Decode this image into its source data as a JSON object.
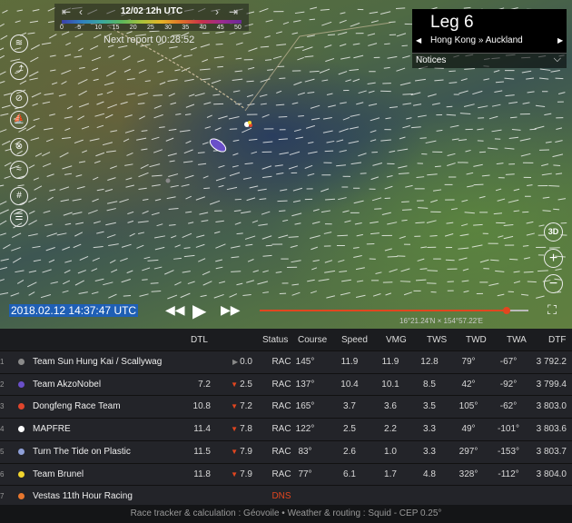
{
  "time_scale": {
    "date": "12/02 12h UTC",
    "ticks": [
      "0",
      "5",
      "10",
      "15",
      "20",
      "25",
      "30",
      "35",
      "40",
      "45",
      "50"
    ],
    "first_icon": "skip-back-icon",
    "prev_icon": "chevron-left-icon",
    "next_icon": "chevron-right-icon",
    "last_icon": "skip-forward-icon"
  },
  "next_report": "Next report 00:28:52",
  "leg": {
    "title": "Leg 6",
    "route": "Hong Kong » Auckland",
    "prev_icon": "chevron-left-icon",
    "next_icon": "chevron-right-icon",
    "notices": "Notices"
  },
  "tools": [
    "layers-icon",
    "route-icon",
    "compass-icon",
    "boat-icon",
    "compass-needle-icon",
    "wind-icon",
    "grid-icon",
    "ruler-icon"
  ],
  "map_controls": {
    "three_d": "3D",
    "zoom_in": "+",
    "zoom_out": "−"
  },
  "playback": {
    "timestamp": "2018.02.12 14:37:47 UTC",
    "progress": 0.92,
    "coords": "16°21.24'N × 154°57.22'E"
  },
  "table": {
    "headers": {
      "dtl": "DTL",
      "status": "Status",
      "course": "Course",
      "speed": "Speed",
      "vmg": "VMG",
      "tws": "TWS",
      "twd": "TWD",
      "twa": "TWA",
      "dtf": "DTF"
    },
    "rows": [
      {
        "rank": "1",
        "color": "#8a8a8a",
        "name": "Team Sun Hung Kai / Scallywag",
        "dtl": "",
        "delta": "0.0",
        "trend": "▶",
        "trend_color": "#888888",
        "status": "RAC",
        "course": "145°",
        "speed": "11.9",
        "vmg": "11.9",
        "tws": "12.8",
        "twd": "79°",
        "twa": "-67°",
        "dtf": "3 792.2"
      },
      {
        "rank": "2",
        "color": "#6a4fc9",
        "name": "Team AkzoNobel",
        "dtl": "7.2",
        "delta": "2.5",
        "trend": "▼",
        "trend_color": "#e2461f",
        "status": "RAC",
        "course": "137°",
        "speed": "10.4",
        "vmg": "10.1",
        "tws": "8.5",
        "twd": "42°",
        "twa": "-92°",
        "dtf": "3 799.4"
      },
      {
        "rank": "3",
        "color": "#e0452c",
        "name": "Dongfeng Race Team",
        "dtl": "10.8",
        "delta": "7.2",
        "trend": "▼",
        "trend_color": "#e2461f",
        "status": "RAC",
        "course": "165°",
        "speed": "3.7",
        "vmg": "3.6",
        "tws": "3.5",
        "twd": "105°",
        "twa": "-62°",
        "dtf": "3 803.0"
      },
      {
        "rank": "4",
        "color": "#ffffff",
        "name": "MAPFRE",
        "dtl": "11.4",
        "delta": "7.8",
        "trend": "▼",
        "trend_color": "#e2461f",
        "status": "RAC",
        "course": "122°",
        "speed": "2.5",
        "vmg": "2.2",
        "tws": "3.3",
        "twd": "49°",
        "twa": "-101°",
        "dtf": "3 803.6"
      },
      {
        "rank": "5",
        "color": "#8fa0d8",
        "name": "Turn The Tide on Plastic",
        "dtl": "11.5",
        "delta": "7.9",
        "trend": "▼",
        "trend_color": "#e2461f",
        "status": "RAC",
        "course": "83°",
        "speed": "2.6",
        "vmg": "1.0",
        "tws": "3.3",
        "twd": "297°",
        "twa": "-153°",
        "dtf": "3 803.7"
      },
      {
        "rank": "6",
        "color": "#f2d52e",
        "name": "Team Brunel",
        "dtl": "11.8",
        "delta": "7.9",
        "trend": "▼",
        "trend_color": "#e2461f",
        "status": "RAC",
        "course": "77°",
        "speed": "6.1",
        "vmg": "1.7",
        "tws": "4.8",
        "twd": "328°",
        "twa": "-112°",
        "dtf": "3 804.0"
      },
      {
        "rank": "7",
        "color": "#e8772e",
        "name": "Vestas 11th Hour Racing",
        "dtl": "",
        "delta": "",
        "trend": "",
        "trend_color": "#888888",
        "status": "DNS",
        "course": "",
        "speed": "",
        "vmg": "",
        "tws": "",
        "twd": "",
        "twa": "",
        "dtf": ""
      }
    ]
  },
  "footer": "Race tracker & calculation : Géovoile • Weather & routing : Squid - CEP 0.25°",
  "colors": {
    "accent": "#e2461f",
    "timestamp_bg": "#1f5fb5",
    "status_dns": "#e2461f"
  }
}
